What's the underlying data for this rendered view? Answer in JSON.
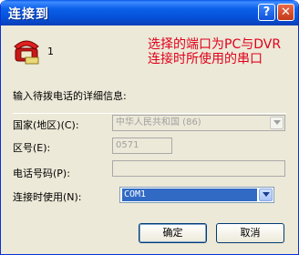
{
  "window": {
    "title": "连接到"
  },
  "titlebar": {
    "help_label": "?",
    "close_label": "✕"
  },
  "connection": {
    "name": "1",
    "icon": "phone-icon"
  },
  "annotation": {
    "text": "选择的端口为PC与DVR连接时所使用的串口",
    "color": "#e0001b"
  },
  "form": {
    "section_label": "输入待拨电话的详细信息:",
    "country_label": "国家(地区)(C):",
    "country_value": "中华人民共和国 (86)",
    "area_label": "区号(E):",
    "area_value": "0571",
    "phone_label": "电话号码(P):",
    "phone_value": "",
    "connect_using_label": "连接时使用(N):",
    "connect_using_value": "COM1"
  },
  "buttons": {
    "ok": "确定",
    "cancel": "取消"
  }
}
